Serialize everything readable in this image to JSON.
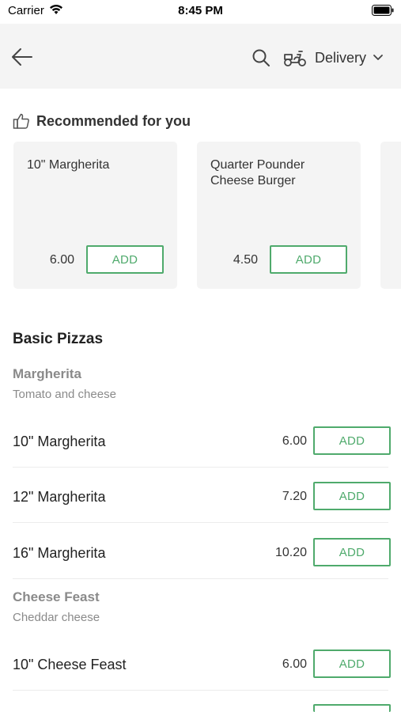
{
  "status_bar": {
    "carrier": "Carrier",
    "time": "8:45 PM"
  },
  "header": {
    "delivery_label": "Delivery"
  },
  "recommended": {
    "title": "Recommended for you",
    "items": [
      {
        "name": "10\" Margherita",
        "price": "6.00",
        "add_label": "ADD"
      },
      {
        "name": "Quarter Pounder Cheese Burger",
        "price": "4.50",
        "add_label": "ADD"
      }
    ]
  },
  "menu": {
    "section_title": "Basic Pizzas",
    "groups": [
      {
        "title": "Margherita",
        "description": "Tomato and cheese",
        "items": [
          {
            "name": "10\" Margherita",
            "price": "6.00",
            "add_label": "ADD"
          },
          {
            "name": "12\" Margherita",
            "price": "7.20",
            "add_label": "ADD"
          },
          {
            "name": "16\" Margherita",
            "price": "10.20",
            "add_label": "ADD"
          }
        ]
      },
      {
        "title": "Cheese Feast",
        "description": "Cheddar cheese",
        "items": [
          {
            "name": "10\" Cheese Feast",
            "price": "6.00",
            "add_label": "ADD"
          }
        ]
      }
    ]
  },
  "colors": {
    "accent": "#4faa6c",
    "header_bg": "#f4f4f4",
    "muted_text": "#8a8a8a"
  },
  "icons": [
    "wifi-icon",
    "battery-icon",
    "back-arrow-icon",
    "search-icon",
    "scooter-icon",
    "chevron-down-icon",
    "thumbs-up-icon"
  ]
}
